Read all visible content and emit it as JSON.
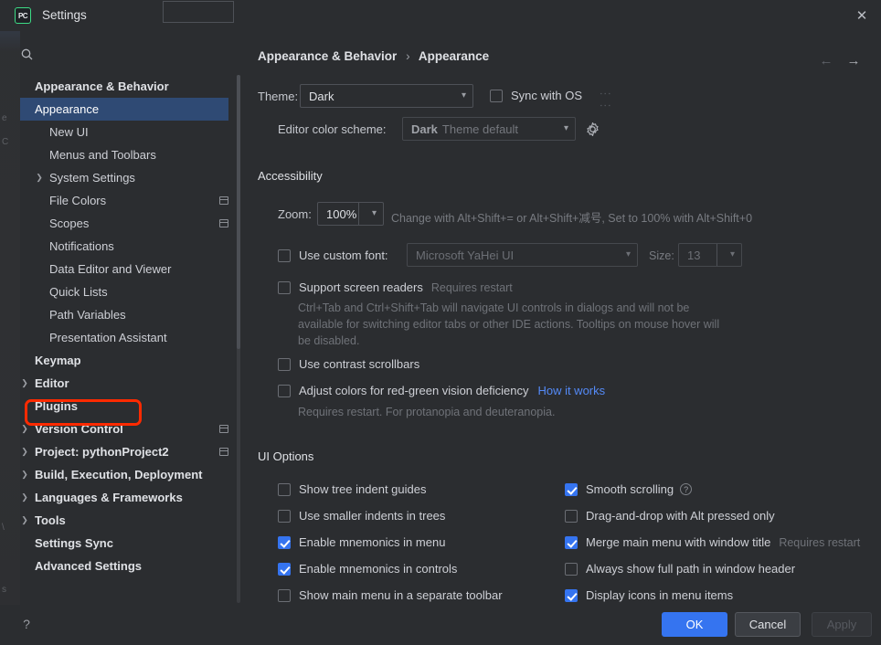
{
  "window": {
    "title": "Settings",
    "app_icon": "pycharm-icon",
    "app_icon_text": "PC",
    "close_icon": "close-icon"
  },
  "search": {
    "placeholder": "",
    "value": "",
    "icon": "search-icon"
  },
  "sidebar": {
    "items": [
      {
        "label": "Appearance & Behavior",
        "type": "group",
        "indent": 16,
        "expandable": false,
        "selected": false
      },
      {
        "label": "Appearance",
        "type": "leaf",
        "indent": 32,
        "expandable": false,
        "selected": true
      },
      {
        "label": "New UI",
        "type": "leaf",
        "indent": 32,
        "expandable": false,
        "selected": false
      },
      {
        "label": "Menus and Toolbars",
        "type": "leaf",
        "indent": 32,
        "expandable": false,
        "selected": false
      },
      {
        "label": "System Settings",
        "type": "leaf",
        "indent": 32,
        "expandable": true,
        "selected": false
      },
      {
        "label": "File Colors",
        "type": "leaf",
        "indent": 32,
        "expandable": false,
        "selected": false,
        "project_icon": true
      },
      {
        "label": "Scopes",
        "type": "leaf",
        "indent": 32,
        "expandable": false,
        "selected": false,
        "project_icon": true
      },
      {
        "label": "Notifications",
        "type": "leaf",
        "indent": 32,
        "expandable": false,
        "selected": false
      },
      {
        "label": "Data Editor and Viewer",
        "type": "leaf",
        "indent": 32,
        "expandable": false,
        "selected": false
      },
      {
        "label": "Quick Lists",
        "type": "leaf",
        "indent": 32,
        "expandable": false,
        "selected": false
      },
      {
        "label": "Path Variables",
        "type": "leaf",
        "indent": 32,
        "expandable": false,
        "selected": false
      },
      {
        "label": "Presentation Assistant",
        "type": "leaf",
        "indent": 32,
        "expandable": false,
        "selected": false
      },
      {
        "label": "Keymap",
        "type": "group",
        "indent": 16,
        "expandable": false,
        "selected": false
      },
      {
        "label": "Editor",
        "type": "group",
        "indent": 16,
        "expandable": true,
        "selected": false
      },
      {
        "label": "Plugins",
        "type": "group",
        "indent": 16,
        "expandable": false,
        "selected": false,
        "annotated": true
      },
      {
        "label": "Version Control",
        "type": "group",
        "indent": 16,
        "expandable": true,
        "selected": false,
        "project_icon": true
      },
      {
        "label": "Project: pythonProject2",
        "type": "group",
        "indent": 16,
        "expandable": true,
        "selected": false,
        "project_icon": true
      },
      {
        "label": "Build, Execution, Deployment",
        "type": "group",
        "indent": 16,
        "expandable": true,
        "selected": false
      },
      {
        "label": "Languages & Frameworks",
        "type": "group",
        "indent": 16,
        "expandable": true,
        "selected": false
      },
      {
        "label": "Tools",
        "type": "group",
        "indent": 16,
        "expandable": true,
        "selected": false
      },
      {
        "label": "Settings Sync",
        "type": "group",
        "indent": 16,
        "expandable": false,
        "selected": false
      },
      {
        "label": "Advanced Settings",
        "type": "group",
        "indent": 16,
        "expandable": false,
        "selected": false
      }
    ],
    "annotation_color": "#ff2a00",
    "selection_color": "#2f4a74"
  },
  "main": {
    "breadcrumb": {
      "parent": "Appearance & Behavior",
      "separator": "›",
      "current": "Appearance"
    },
    "nav": {
      "back_icon": "arrow-left-icon",
      "forward_icon": "arrow-right-icon"
    },
    "theme": {
      "label": "Theme:",
      "value": "Dark",
      "sync_label": "Sync with OS",
      "sync_checked": false,
      "dots_icon": "drag-dots-icon"
    },
    "color_scheme": {
      "label": "Editor color scheme:",
      "value": "Dark",
      "value_suffix": "Theme default",
      "disabled": true,
      "gear_icon": "gear-icon"
    },
    "accessibility": {
      "title": "Accessibility",
      "zoom_label": "Zoom:",
      "zoom_value": "100%",
      "zoom_hint": "Change with Alt+Shift+= or Alt+Shift+减号, Set to 100% with Alt+Shift+0",
      "custom_font_label": "Use custom font:",
      "custom_font_checked": false,
      "custom_font_value": "Microsoft YaHei UI",
      "size_label": "Size:",
      "size_value": "13",
      "screen_readers_label": "Support screen readers",
      "screen_readers_note": "Requires restart",
      "screen_readers_checked": false,
      "screen_readers_desc": "Ctrl+Tab and Ctrl+Shift+Tab will navigate UI controls in dialogs and will not be available for switching editor tabs or other IDE actions. Tooltips on mouse hover will be disabled.",
      "contrast_scrollbars_label": "Use contrast scrollbars",
      "contrast_scrollbars_checked": false,
      "red_green_label": "Adjust colors for red-green vision deficiency",
      "red_green_checked": false,
      "red_green_link": "How it works",
      "red_green_desc": "Requires restart. For protanopia and deuteranopia."
    },
    "ui_options": {
      "title": "UI Options",
      "left": [
        {
          "label": "Show tree indent guides",
          "checked": false
        },
        {
          "label": "Use smaller indents in trees",
          "checked": false
        },
        {
          "label": "Enable mnemonics in menu",
          "checked": true
        },
        {
          "label": "Enable mnemonics in controls",
          "checked": true
        },
        {
          "label": "Show main menu in a separate toolbar",
          "checked": false
        }
      ],
      "right": [
        {
          "label": "Smooth scrolling",
          "checked": true,
          "help_icon": true
        },
        {
          "label": "Drag-and-drop with Alt pressed only",
          "checked": false
        },
        {
          "label": "Merge main menu with window title",
          "checked": true,
          "note": "Requires restart"
        },
        {
          "label": "Always show full path in window header",
          "checked": false
        },
        {
          "label": "Display icons in menu items",
          "checked": true
        }
      ]
    }
  },
  "footer": {
    "help_icon": "help-icon",
    "ok_label": "OK",
    "cancel_label": "Cancel",
    "apply_label": "Apply",
    "apply_disabled": true,
    "accent_color": "#3574f0"
  }
}
